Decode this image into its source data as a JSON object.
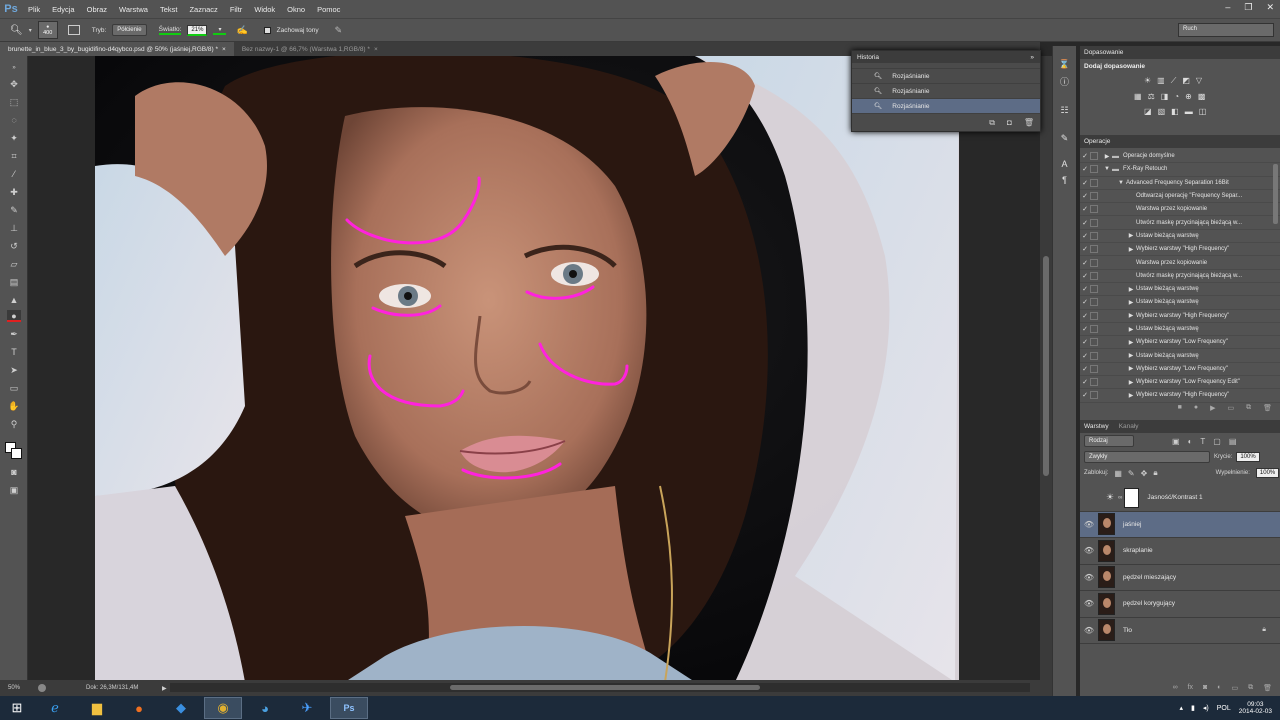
{
  "app": {
    "logo": "Ps"
  },
  "menu": [
    "Plik",
    "Edycja",
    "Obraz",
    "Warstwa",
    "Tekst",
    "Zaznacz",
    "Filtr",
    "Widok",
    "Okno",
    "Pomoc"
  ],
  "window_buttons": [
    "–",
    "❐",
    "✕"
  ],
  "options": {
    "brush_size": "400",
    "mode_label": "Tryb:",
    "mode_value": "Półcienie",
    "exposure_label": "Światło:",
    "exposure_value": "21%",
    "protect_tones": "Zachowaj tony"
  },
  "workspace": "Ruch",
  "tabs": [
    {
      "label": "brunette_in_blue_3_by_bugidifino-d4qybco.psd @ 50% (jaśniej,RGB/8) *",
      "close": "×"
    },
    {
      "label": "Bez nazwy-1 @ 66,7% (Warstwa 1,RGB/8) *",
      "close": "×"
    }
  ],
  "status": {
    "zoom": "50%",
    "doc": "Dok: 26,3M/131,4M",
    "arrow": "▶"
  },
  "history": {
    "title": "Historia",
    "items": [
      {
        "label": "Rozjaśnianie",
        "selected": false
      },
      {
        "label": "Rozjaśnianie",
        "selected": false
      },
      {
        "label": "Rozjaśnianie",
        "selected": true
      }
    ]
  },
  "adjustments": {
    "title": "Dopasowanie",
    "subtitle": "Dodaj dopasowanie"
  },
  "actions": {
    "title": "Operacje",
    "items": [
      {
        "label": "Operacje domyślne",
        "level": 0,
        "folder": true,
        "open": false
      },
      {
        "label": "FX-Ray Retouch",
        "level": 0,
        "folder": true,
        "open": true
      },
      {
        "label": "Advanced Frequency Separation 16Bit",
        "level": 1,
        "folder": false,
        "open": true
      },
      {
        "label": "Odtwarzaj operację \"Frequency Separ...",
        "level": 2,
        "folder": false,
        "open": false,
        "noarrow": true
      },
      {
        "label": "Warstwa przez kopiowanie",
        "level": 2,
        "folder": false,
        "open": false,
        "noarrow": true
      },
      {
        "label": "Utwórz maskę przycinającą bieżącą w...",
        "level": 2,
        "folder": false,
        "open": false,
        "noarrow": true
      },
      {
        "label": "Ustaw bieżącą warstwę",
        "level": 2,
        "folder": false,
        "open": false
      },
      {
        "label": "Wybierz warstwy \"High Frequency\"",
        "level": 2,
        "folder": false,
        "open": false
      },
      {
        "label": "Warstwa przez kopiowanie",
        "level": 2,
        "folder": false,
        "open": false,
        "noarrow": true
      },
      {
        "label": "Utwórz maskę przycinającą bieżącą w...",
        "level": 2,
        "folder": false,
        "open": false,
        "noarrow": true
      },
      {
        "label": "Ustaw bieżącą warstwę",
        "level": 2,
        "folder": false,
        "open": false
      },
      {
        "label": "Ustaw bieżącą warstwę",
        "level": 2,
        "folder": false,
        "open": false
      },
      {
        "label": "Wybierz warstwy \"High Frequency\"",
        "level": 2,
        "folder": false,
        "open": false
      },
      {
        "label": "Ustaw bieżącą warstwę",
        "level": 2,
        "folder": false,
        "open": false
      },
      {
        "label": "Wybierz warstwy \"Low Frequency\"",
        "level": 2,
        "folder": false,
        "open": false
      },
      {
        "label": "Ustaw bieżącą warstwę",
        "level": 2,
        "folder": false,
        "open": false
      },
      {
        "label": "Wybierz warstwy \"Low Frequency\"",
        "level": 2,
        "folder": false,
        "open": false
      },
      {
        "label": "Wybierz warstwy \"Low Frequency Edit\"",
        "level": 2,
        "folder": false,
        "open": false
      },
      {
        "label": "Wybierz warstwy \"High Frequency\"",
        "level": 2,
        "folder": false,
        "open": false
      }
    ]
  },
  "layers": {
    "tab_active": "Warstwy",
    "tab_inactive": "Kanały",
    "filter": "Rodzaj",
    "blend": "Zwykły",
    "opacity_label": "Krycie:",
    "opacity": "100%",
    "lock_label": "Zablokuj:",
    "fill_label": "Wypełnienie:",
    "fill": "100%",
    "items": [
      {
        "label": "Jasność/Kontrast 1",
        "adjustment": true,
        "visible": false,
        "selected": false,
        "locked": false
      },
      {
        "label": "jaśniej",
        "adjustment": false,
        "visible": true,
        "selected": true,
        "locked": false
      },
      {
        "label": "skraplanie",
        "adjustment": false,
        "visible": true,
        "selected": false,
        "locked": false
      },
      {
        "label": "pędzel mieszający",
        "adjustment": false,
        "visible": true,
        "selected": false,
        "locked": false
      },
      {
        "label": "pędzel korygujący",
        "adjustment": false,
        "visible": true,
        "selected": false,
        "locked": false
      },
      {
        "label": "Tło",
        "adjustment": false,
        "visible": true,
        "selected": false,
        "locked": true
      }
    ]
  },
  "taskbar": {
    "lang": "POL",
    "time": "09:03",
    "date": "2014-02-03",
    "apps": [
      "start",
      "ie",
      "explorer",
      "firefox",
      "dropbox",
      "chrome",
      "thunderbird",
      "photos",
      "photoshop"
    ]
  },
  "colors": {
    "annotation": "#ff22dd",
    "highlight": "#11cc11",
    "selection": "#5d6c86"
  }
}
